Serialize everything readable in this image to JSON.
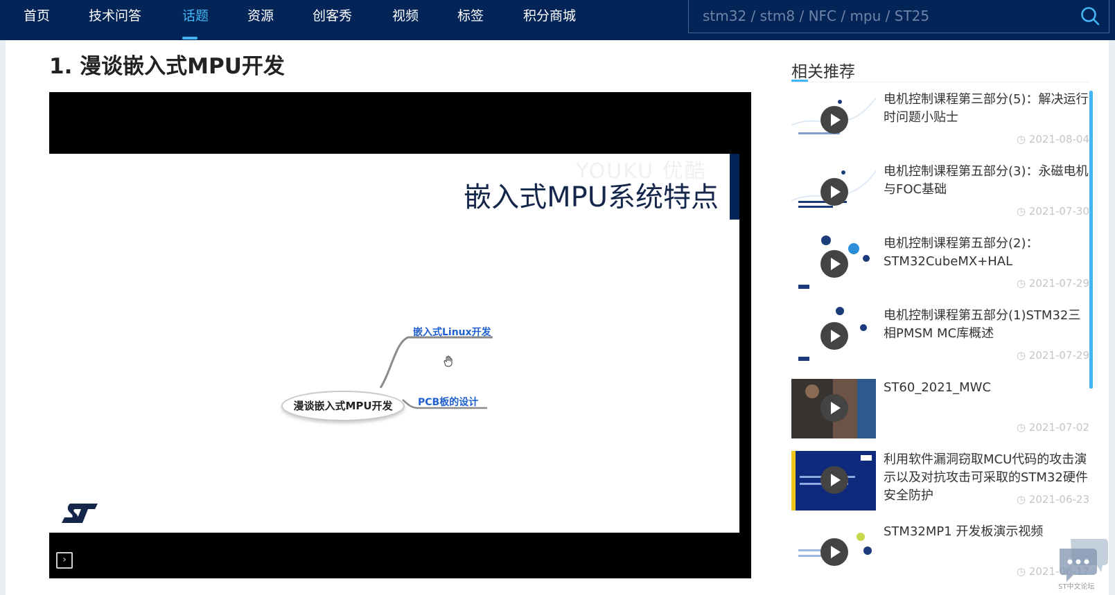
{
  "nav": {
    "items": [
      "首页",
      "技术问答",
      "话题",
      "资源",
      "创客秀",
      "视频",
      "标签",
      "积分商城"
    ],
    "active_index": 2,
    "search_placeholder": "stm32 / stm8 / NFC / mpu / ST25"
  },
  "article": {
    "title": "1. 漫谈嵌入式MPU开发"
  },
  "video": {
    "watermark": "YOUKU 优酷",
    "slide_heading": "嵌入式MPU系统特点",
    "mindmap_root": "漫谈嵌入式MPU开发",
    "mindmap_nodes": [
      "嵌入式Linux开发",
      "PCB板的设计"
    ]
  },
  "sidebar": {
    "title": "相关推荐",
    "items": [
      {
        "title": "电机控制课程第三部分(5)：解决运行时问题小贴士",
        "date": "2021-08-04"
      },
      {
        "title": "电机控制课程第五部分(3)：永磁电机与FOC基础",
        "date": "2021-07-30"
      },
      {
        "title": "电机控制课程第五部分(2)：STM32CubeMX+HAL",
        "date": "2021-07-29"
      },
      {
        "title": "电机控制课程第五部分(1)STM32三相PMSM MC库概述",
        "date": "2021-07-29"
      },
      {
        "title": "ST60_2021_MWC",
        "date": "2021-07-02"
      },
      {
        "title": "利用软件漏洞窃取MCU代码的攻击演示以及对抗攻击可采取的STM32硬件安全防护",
        "date": "2021-06-23"
      },
      {
        "title": "STM32MP1 开发板演示视频",
        "date": "2021-06-17"
      }
    ]
  },
  "chat_widget_label": "ST中文论坛",
  "colors": {
    "nav_bg": "#032456",
    "accent": "#41b5f5"
  }
}
